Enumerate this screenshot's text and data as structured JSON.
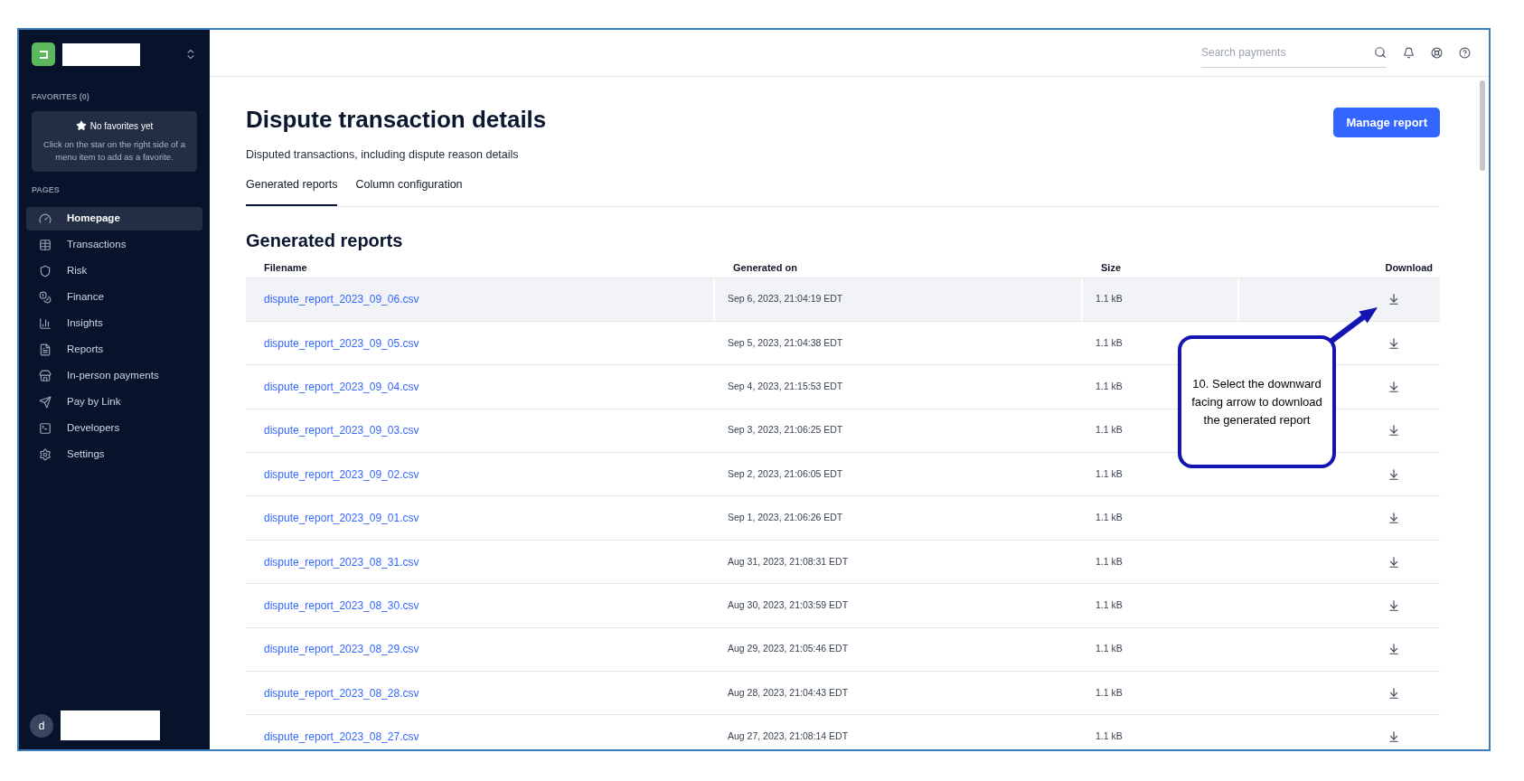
{
  "sidebar": {
    "favorites_heading": "FAVORITES (0)",
    "favorites_empty": {
      "title": "No favorites yet",
      "text": "Click on the star on the right side of a menu item to add as a favorite."
    },
    "pages_heading": "PAGES",
    "items": [
      {
        "label": "Homepage",
        "selected": true
      },
      {
        "label": "Transactions",
        "selected": false
      },
      {
        "label": "Risk",
        "selected": false
      },
      {
        "label": "Finance",
        "selected": false
      },
      {
        "label": "Insights",
        "selected": false
      },
      {
        "label": "Reports",
        "selected": false
      },
      {
        "label": "In-person payments",
        "selected": false
      },
      {
        "label": "Pay by Link",
        "selected": false
      },
      {
        "label": "Developers",
        "selected": false
      },
      {
        "label": "Settings",
        "selected": false
      }
    ],
    "user_initial": "d"
  },
  "topbar": {
    "search": {
      "placeholder": "Search payments"
    }
  },
  "page": {
    "title": "Dispute transaction details",
    "subtitle": "Disputed transactions, including dispute reason details",
    "action": "Manage report",
    "tabs": [
      {
        "label": "Generated reports",
        "selected": true
      },
      {
        "label": "Column configuration",
        "selected": false
      }
    ],
    "section_title": "Generated reports",
    "table": {
      "columns": [
        "Filename",
        "Generated on",
        "Size",
        "Download"
      ],
      "rows": [
        {
          "filename": "dispute_report_2023_09_06.csv",
          "generated_on": "Sep 6, 2023, 21:04:19 EDT",
          "size": "1.1 kB",
          "highlighted": true
        },
        {
          "filename": "dispute_report_2023_09_05.csv",
          "generated_on": "Sep 5, 2023, 21:04:38 EDT",
          "size": "1.1 kB",
          "highlighted": false
        },
        {
          "filename": "dispute_report_2023_09_04.csv",
          "generated_on": "Sep 4, 2023, 21:15:53 EDT",
          "size": "1.1 kB",
          "highlighted": false
        },
        {
          "filename": "dispute_report_2023_09_03.csv",
          "generated_on": "Sep 3, 2023, 21:06:25 EDT",
          "size": "1.1 kB",
          "highlighted": false
        },
        {
          "filename": "dispute_report_2023_09_02.csv",
          "generated_on": "Sep 2, 2023, 21:06:05 EDT",
          "size": "1.1 kB",
          "highlighted": false
        },
        {
          "filename": "dispute_report_2023_09_01.csv",
          "generated_on": "Sep 1, 2023, 21:06:26 EDT",
          "size": "1.1 kB",
          "highlighted": false
        },
        {
          "filename": "dispute_report_2023_08_31.csv",
          "generated_on": "Aug 31, 2023, 21:08:31 EDT",
          "size": "1.1 kB",
          "highlighted": false
        },
        {
          "filename": "dispute_report_2023_08_30.csv",
          "generated_on": "Aug 30, 2023, 21:03:59 EDT",
          "size": "1.1 kB",
          "highlighted": false
        },
        {
          "filename": "dispute_report_2023_08_29.csv",
          "generated_on": "Aug 29, 2023, 21:05:46 EDT",
          "size": "1.1 kB",
          "highlighted": false
        },
        {
          "filename": "dispute_report_2023_08_28.csv",
          "generated_on": "Aug 28, 2023, 21:04:43 EDT",
          "size": "1.1 kB",
          "highlighted": false
        },
        {
          "filename": "dispute_report_2023_08_27.csv",
          "generated_on": "Aug 27, 2023, 21:08:14 EDT",
          "size": "1.1 kB",
          "highlighted": false
        }
      ]
    }
  },
  "callout": {
    "text": "10. Select the downward facing arrow to download the generated report"
  }
}
